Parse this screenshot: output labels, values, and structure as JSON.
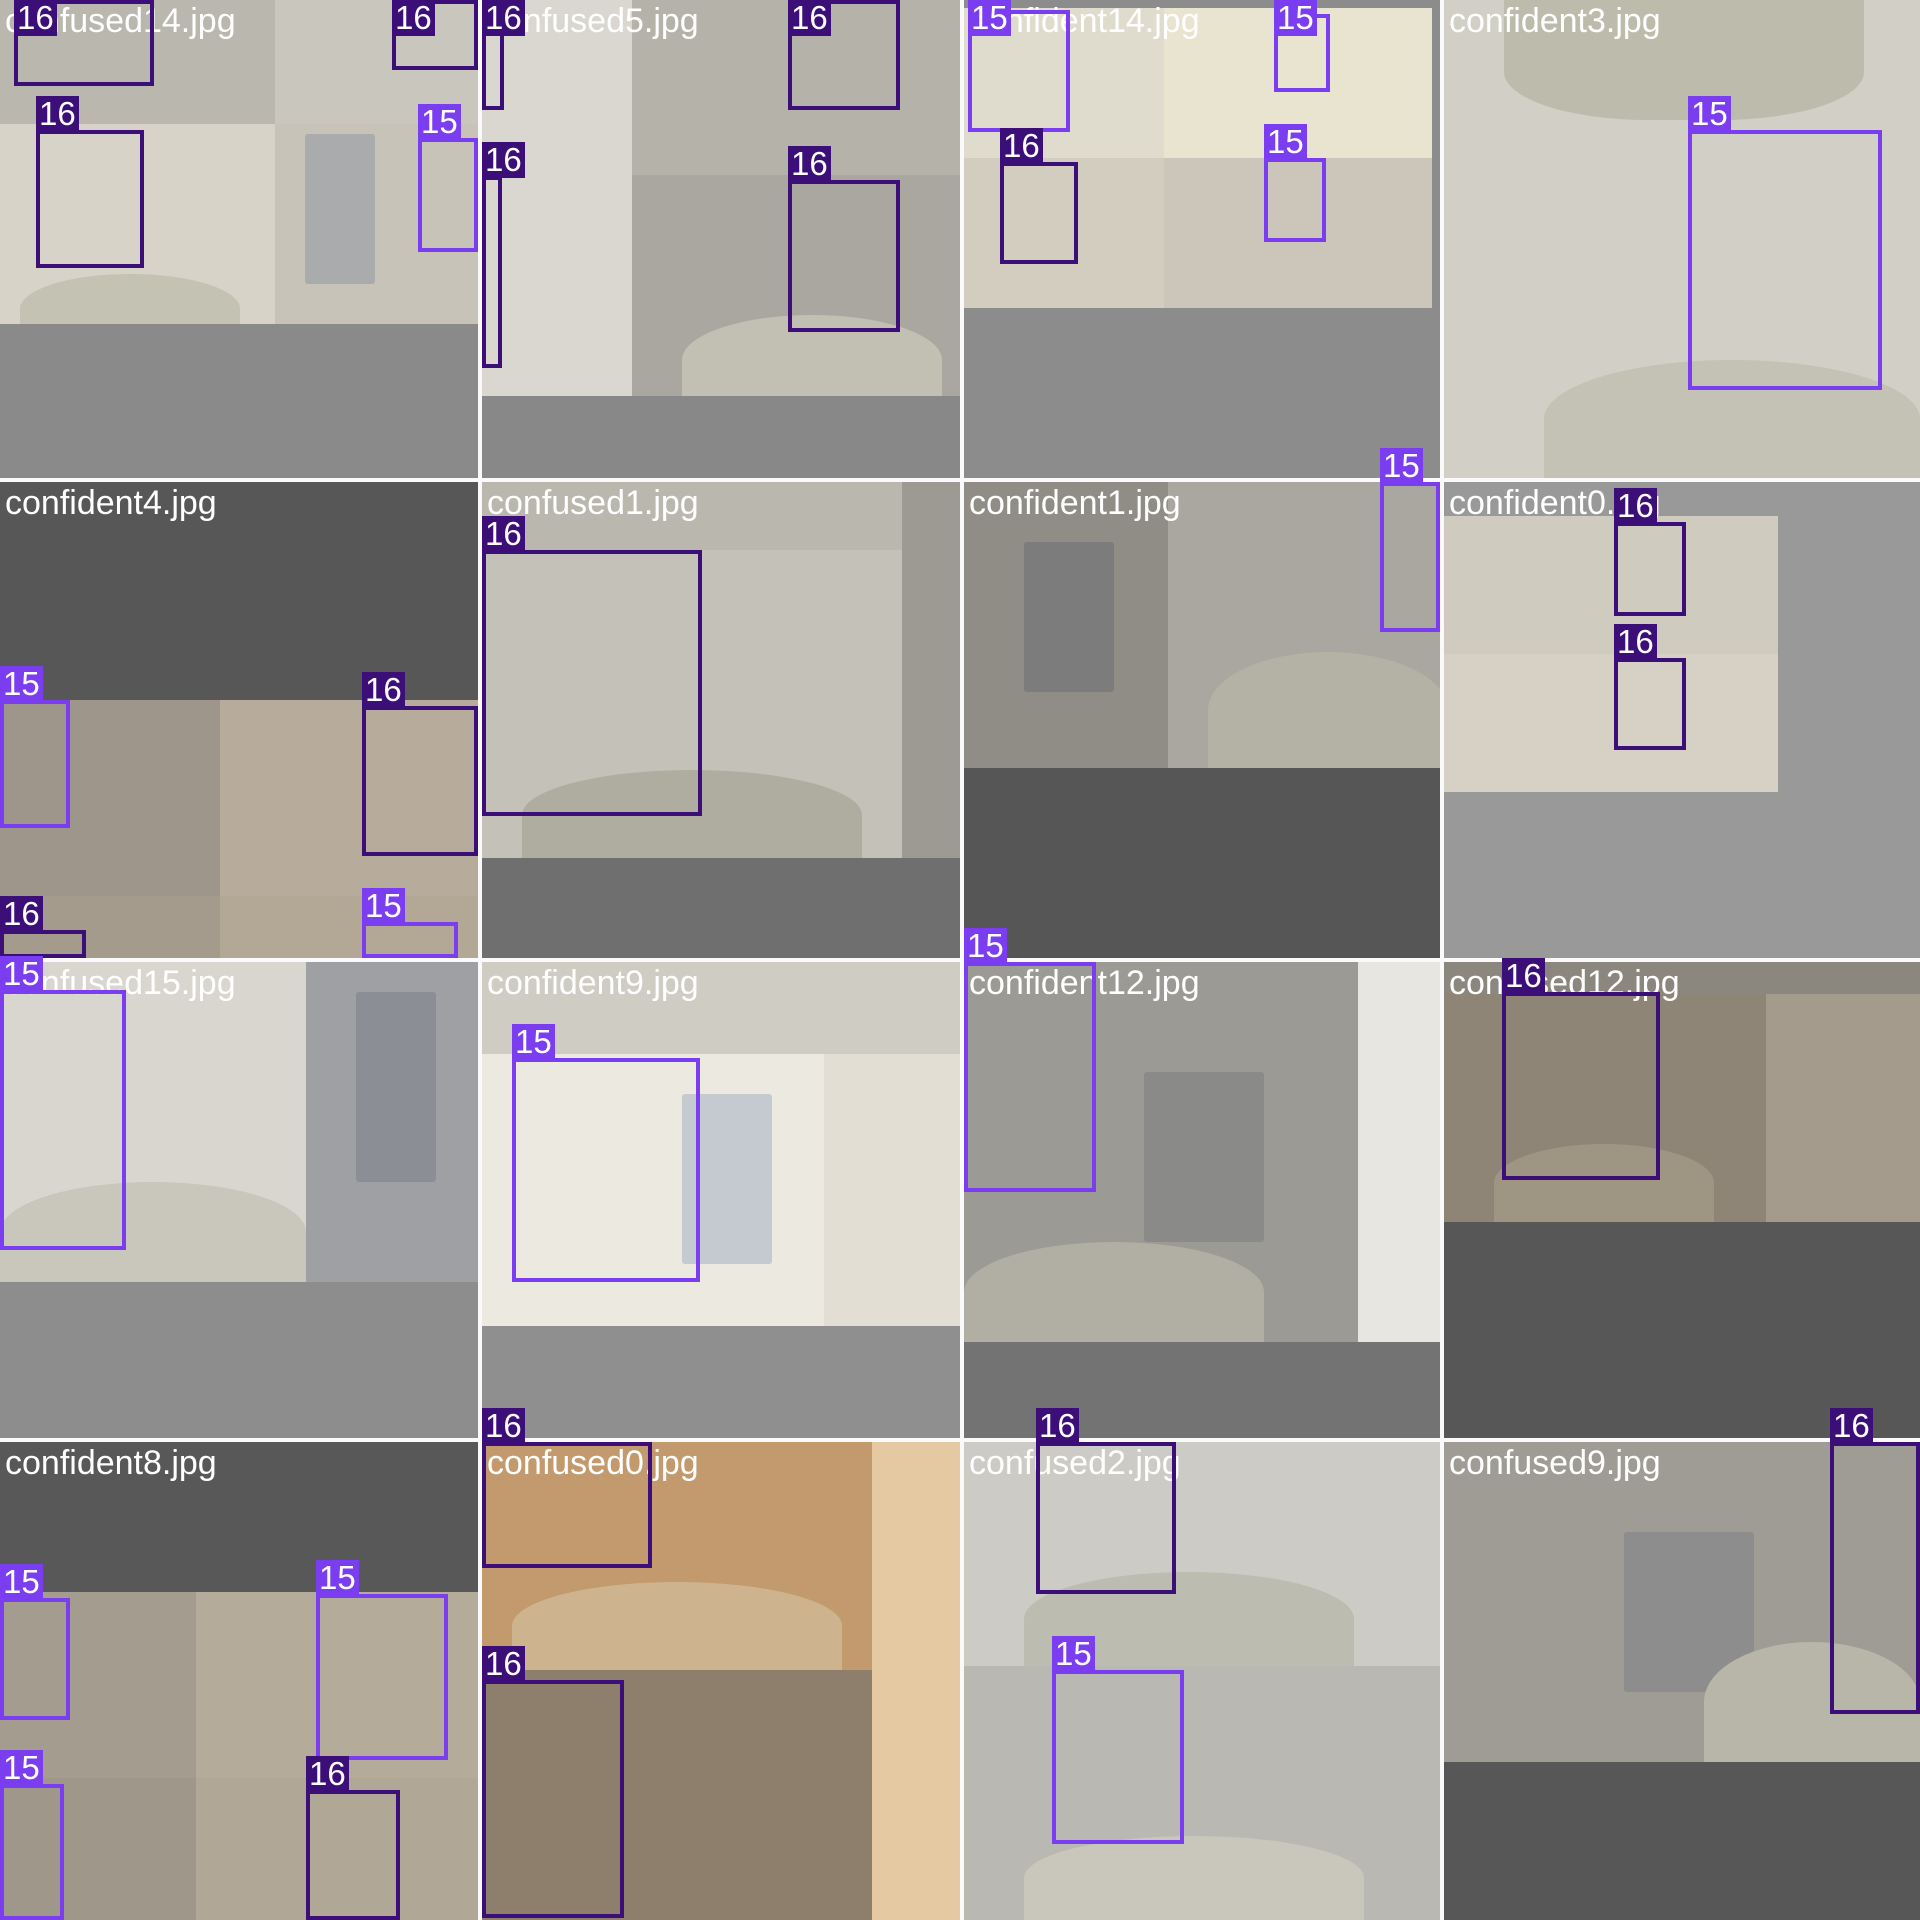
{
  "colors": {
    "class_15": "#7a3df0",
    "class_16": "#3c0f78",
    "label_text": "#ffffff",
    "divider": "#fafafa"
  },
  "classes": {
    "15": "15",
    "16": "16"
  },
  "tiles": [
    {
      "name": "confused14.jpg"
    },
    {
      "name": "confused5.jpg"
    },
    {
      "name": "confident14.jpg"
    },
    {
      "name": "confident3.jpg"
    },
    {
      "name": "confident4.jpg"
    },
    {
      "name": "confused1.jpg"
    },
    {
      "name": "confident1.jpg"
    },
    {
      "name": "confident0.jpg"
    },
    {
      "name": "confused15.jpg"
    },
    {
      "name": "confident9.jpg"
    },
    {
      "name": "confident12.jpg"
    },
    {
      "name": "confused12.jpg"
    },
    {
      "name": "confident8.jpg"
    },
    {
      "name": "confused0.jpg"
    },
    {
      "name": "confused2.jpg"
    },
    {
      "name": "confused9.jpg"
    }
  ]
}
